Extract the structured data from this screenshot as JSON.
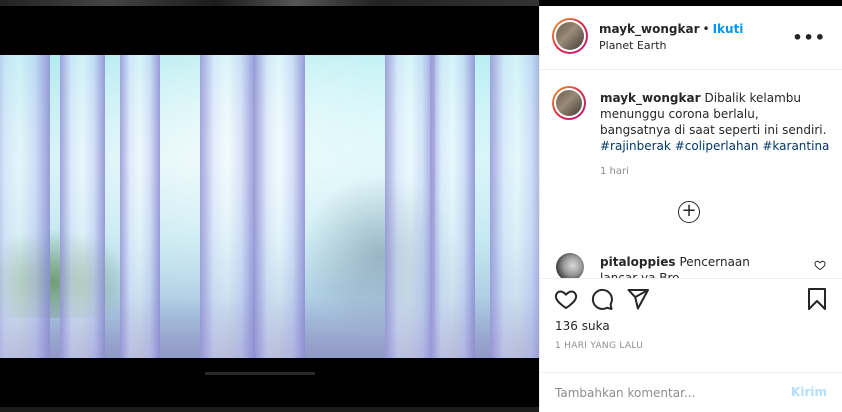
{
  "header": {
    "username": "mayk_wongkar",
    "separator": "•",
    "follow_label": "Ikuti",
    "location": "Planet Earth",
    "more_label": "•••"
  },
  "caption": {
    "username": "mayk_wongkar",
    "text": "Dibalik kelambu menunggu corona berlalu, bangsatnya di saat seperti ini sendiri.",
    "hashtags": [
      "#rajinberak",
      "#coliperlahan",
      "#karantina"
    ],
    "time": "1 hari"
  },
  "load_more": {
    "label": "+"
  },
  "comments": [
    {
      "username": "pitaloppies",
      "text": "Pencernaan lancar ya Bro"
    }
  ],
  "actions": {
    "likes": "136 suka",
    "date": "1 HARI YANG LALU"
  },
  "add_comment": {
    "placeholder": "Tambahkan komentar...",
    "post_label": "Kirim"
  },
  "colors": {
    "link": "#0095f6",
    "hashtag": "#00376b",
    "muted": "#8e8e8e",
    "post_disabled": "#b2dffc"
  },
  "icons": [
    "more-icon",
    "add-circle-icon",
    "heart-icon",
    "comment-icon",
    "share-icon",
    "bookmark-icon"
  ]
}
